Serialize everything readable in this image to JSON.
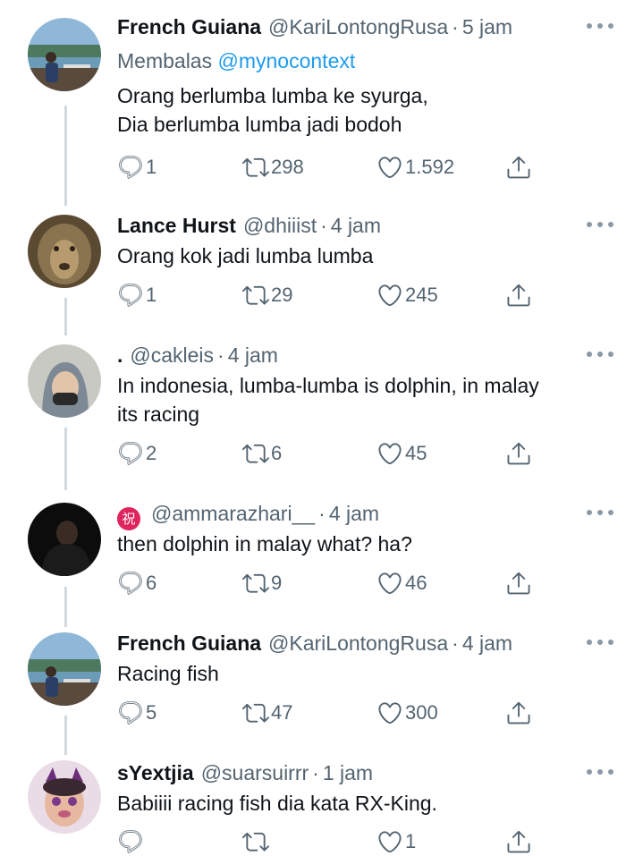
{
  "colors": {
    "text": "#0f1419",
    "secondary": "#536471",
    "link": "#1d9bf0",
    "thread_line": "#cfd9de"
  },
  "tweets": [
    {
      "name": "French Guiana",
      "handle": "@KariLontongRusa",
      "time": "5 jam",
      "replying_prefix": "Membalas",
      "replying_to": "@mynocontext",
      "lines": [
        "Orang berlumba lumba ke syurga,",
        "Dia berlumba lumba jadi bodoh"
      ],
      "replies": "1",
      "retweets": "298",
      "likes": "1.592",
      "avatar_icon": "lake-photo-avatar"
    },
    {
      "name": "Lance Hurst",
      "handle": "@dhiiist",
      "time": "4 jam",
      "lines": [
        "Orang kok jadi lumba lumba"
      ],
      "replies": "1",
      "retweets": "29",
      "likes": "245",
      "avatar_icon": "lion-photo-avatar"
    },
    {
      "name": ".",
      "handle": "@cakleis",
      "time": "4 jam",
      "lines": [
        "In indonesia, lumba-lumba is dolphin, in malay",
        "its racing"
      ],
      "replies": "2",
      "retweets": "6",
      "likes": "45",
      "avatar_icon": "hijab-person-avatar"
    },
    {
      "name": "祝",
      "handle": "@ammarazhari__",
      "time": "4 jam",
      "lines": [
        "then dolphin in malay what? ha?"
      ],
      "replies": "6",
      "retweets": "9",
      "likes": "46",
      "avatar_icon": "dark-person-avatar"
    },
    {
      "name": "French Guiana",
      "handle": "@KariLontongRusa",
      "time": "4 jam",
      "lines": [
        "Racing fish"
      ],
      "replies": "5",
      "retweets": "47",
      "likes": "300",
      "avatar_icon": "lake-photo-avatar"
    },
    {
      "name": "sYextjia",
      "handle": "@suarsuirrr",
      "time": "1 jam",
      "lines": [
        "Babiiii racing fish dia kata RX-King."
      ],
      "replies": "",
      "retweets": "",
      "likes": "1",
      "avatar_icon": "cat-filter-avatar"
    }
  ]
}
